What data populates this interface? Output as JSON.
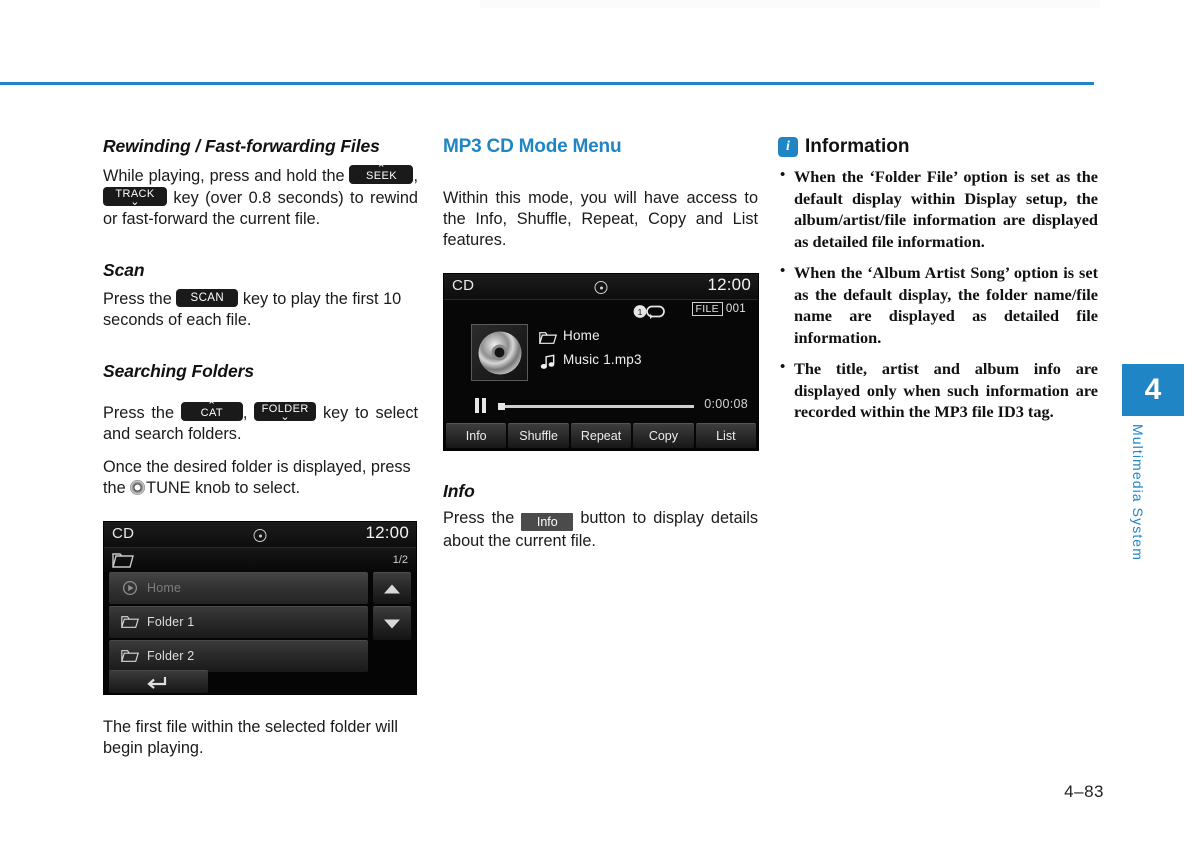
{
  "page": {
    "number": "4–83",
    "chapter_number": "4",
    "chapter_label": "Multimedia System",
    "accent_color": "#1f85c4"
  },
  "col1": {
    "s1_heading": "Rewinding / Fast-forwarding Files",
    "s1_text_a": "While playing, press and hold the",
    "s1_key_seek": "SEEK",
    "s1_key_seek_arrow": "⌃",
    "s1_comma": ",",
    "s1_key_track": "TRACK",
    "s1_key_track_arrow": "⌄",
    "s1_text_b": "key (over 0.8 seconds) to rewind or fast-forward the current file.",
    "s2_heading": "Scan",
    "s2_text_a": "Press the",
    "s2_key_scan": "SCAN",
    "s2_text_b": "key to play the first 10 seconds of each file.",
    "s3_heading": "Searching Folders",
    "s3_text_a": "Press the",
    "s3_key_cat": "CAT",
    "s3_key_cat_arrow": "⌃",
    "s3_comma": ",",
    "s3_key_folder": "FOLDER",
    "s3_key_folder_arrow": "⌄",
    "s3_text_b": "key to select and search folders.",
    "s3_text_c1": "Once the desired folder is displayed, press the",
    "s3_text_c2": "TUNE knob to select.",
    "s4_text": "The first file within the selected folder will begin playing."
  },
  "folder_browser": {
    "source": "CD",
    "disc_icon": "disc-icon",
    "clock": "12:00",
    "breadcrumb_icon": "folder-icon",
    "page_indicator": "1/2",
    "rows": [
      {
        "label": "Home",
        "icon": "play-circle-icon",
        "state": "dimmed"
      },
      {
        "label": "Folder 1",
        "icon": "folder-icon",
        "state": "normal"
      },
      {
        "label": "Folder 2",
        "icon": "folder-icon",
        "state": "normal"
      }
    ],
    "scroll_up_icon": "triangle-up-icon",
    "scroll_down_icon": "triangle-down-icon",
    "back_icon": "back-arrow-icon"
  },
  "col2": {
    "heading": "MP3 CD Mode Menu",
    "intro": "Within this mode, you will have access to the Info, Shuffle, Repeat, Copy and List features.",
    "info_heading": "Info",
    "info_text_a": "Press the",
    "info_chip": "Info",
    "info_text_b": "button to display details about the current file."
  },
  "now_playing": {
    "source": "CD",
    "disc_icon": "disc-icon",
    "clock": "12:00",
    "repeat_icon": "repeat-one-icon",
    "file_badge": "FILE",
    "file_number": "001",
    "album_art_icon": "cd-disc-icon",
    "folder_icon": "folder-icon",
    "folder_name": "Home",
    "track_icon": "music-note-icon",
    "track_name": "Music 1.mp3",
    "transport_icon": "pause-icon",
    "elapsed_time": "0:00:08",
    "progress_percent": 2,
    "keys": [
      "Info",
      "Shuffle",
      "Repeat",
      "Copy",
      "List"
    ]
  },
  "col3": {
    "badge": "i",
    "title": "Information",
    "bullets": [
      "When the ‘Folder File’ option is set as the default display within Display setup, the album/artist/file information are displayed as detailed file information.",
      "When the ‘Album Artist Song’ option is set as the default display, the folder name/file name are displayed as detailed file information.",
      "The title, artist and album info are displayed only when such information are recorded within the MP3 file ID3 tag."
    ]
  }
}
